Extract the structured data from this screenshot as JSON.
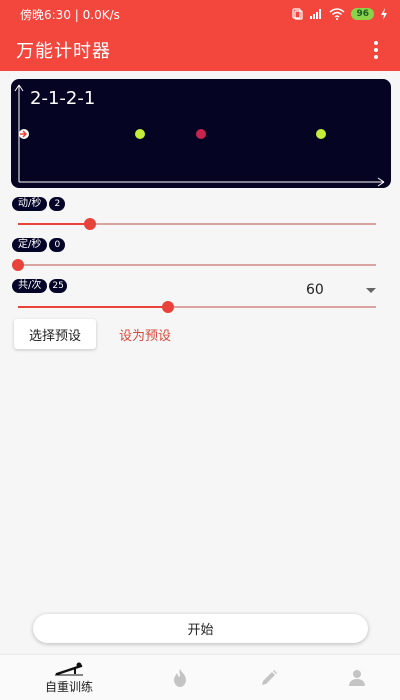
{
  "status_bar": {
    "time_text": "傍晚6:30 | 0.0K/s",
    "battery": "96"
  },
  "app_bar": {
    "title": "万能计时器",
    "menu_icon": "more-vert-icon"
  },
  "timer_panel": {
    "pattern_label": "2-1-2-1",
    "background": "#050523",
    "dot_colors": [
      "#c6ec3a",
      "#c8234f",
      "#c6ec3a"
    ],
    "indicator_color": "#e8433a"
  },
  "sliders": [
    {
      "label": "动/秒",
      "value": "2",
      "fraction": 0.2
    },
    {
      "label": "定/秒",
      "value": "0",
      "fraction": 0.0
    },
    {
      "label": "共/次",
      "value": "25",
      "fraction": 0.42
    }
  ],
  "dropdown": {
    "selected": "60"
  },
  "buttons": {
    "select_preset": "选择预设",
    "set_preset": "设为预设",
    "start": "开始"
  },
  "bottom_nav": {
    "items": [
      {
        "label": "自重训练",
        "icon": "pushup-icon",
        "active": true
      },
      {
        "label": "",
        "icon": "fire-icon",
        "active": false
      },
      {
        "label": "",
        "icon": "pencil-icon",
        "active": false
      },
      {
        "label": "",
        "icon": "person-icon",
        "active": false
      }
    ]
  },
  "colors": {
    "accent": "#f3473d",
    "slider": "#e8433a",
    "link": "#d94a3a"
  }
}
